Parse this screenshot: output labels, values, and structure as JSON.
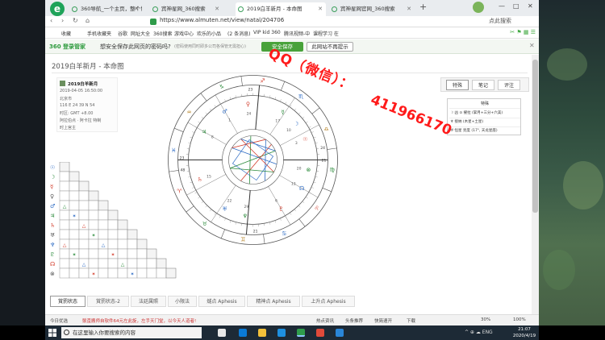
{
  "browser": {
    "tabs": [
      {
        "label": "360导航_一个主页，整个世界",
        "active": false
      },
      {
        "label": "宾神星网_360搜索",
        "active": false
      },
      {
        "label": "2019白羊新月 - 本命图",
        "active": true
      },
      {
        "label": "宾神星网官网_360搜索",
        "active": false
      }
    ],
    "new_tab": "+",
    "window_controls": [
      "—",
      "□",
      "✕"
    ],
    "url": "https://www.almuten.net/view/natal/204706",
    "search_placeholder": "点此搜索",
    "nav": {
      "back": "‹",
      "forward": "›",
      "reload": "↻",
      "home": "⌂"
    },
    "bookmarks": [
      "收藏",
      "手机收藏夹",
      "谷歌",
      "网址大全",
      "360搜索",
      "游戏中心",
      "欢乐的小品",
      "(2 条消息)",
      "VIP kid 360",
      "腾讯视频-中",
      "课程学习 在"
    ]
  },
  "prompt_bar": {
    "brand": "360 登录管家",
    "question": "想安全保存此网页的密码吗?",
    "subtext": "(密码使用同时即多公司各保管无需担心)",
    "save_label": "安全保存",
    "never_label": "此网站不再提示",
    "close": "✕"
  },
  "page": {
    "title": "2019白羊新月 - 本命图",
    "person": {
      "name": "2019白羊新月",
      "lines": [
        "2019-04-05 16:50:00",
        "北京市",
        "116 E 24  39 N 54",
        "时区: GMT +8.00",
        "阿拉伯点 · 阿卡拉 特制",
        "时上宫主"
      ]
    },
    "right_tabs": [
      "特殊",
      "笔记",
      "评注"
    ],
    "right_panel": {
      "header": "特殊",
      "lines": [
        "☽ 凶 ⊙ 擢拉 (掌月+三分+六美)",
        "♆ 接纳 (木星+土星)",
        "♅ 恒星 亮度 (17°, 天龙星座)"
      ]
    },
    "watermark_line1": "QQ（微信）：",
    "watermark_line2": "411966170",
    "bottom_tabs": [
      "賞罰状态",
      "賞罰状态-2",
      "法廷属照",
      "小限法",
      "燧点 Aphesis",
      "精神点 Aphesis",
      "上升点 Aphesis"
    ]
  },
  "chart_glyphs": {
    "signs": [
      "♈",
      "♉",
      "♊",
      "♋",
      "♌",
      "♍",
      "♎",
      "♏",
      "♐",
      "♑",
      "♒",
      "♓"
    ],
    "planets": [
      "☉",
      "☽",
      "☿",
      "♀",
      "♂",
      "♃",
      "♄",
      "♅",
      "♆",
      "♇",
      "☊",
      "⊗"
    ],
    "cusp_numbers": [
      "23",
      "48",
      "21",
      "24",
      "23",
      "21"
    ]
  },
  "status_bar": {
    "left": "今日优选",
    "news": "鬃歪搬师自软件64元左此旋，左手天门堂，以今天人道者!",
    "items": [
      "热点资讯",
      "头条推荐",
      "快简速开",
      "下载",
      "30%",
      "100%"
    ]
  },
  "taskbar": {
    "search_text": "在这里输入你要搜索的内容",
    "time": "21:07",
    "date": "2020/4/19",
    "tray": "^  ⊕  ☁  ENG"
  },
  "colors": {
    "fire": "#d23b2a",
    "water": "#2d6bc4",
    "earth": "#2a8a3a",
    "accent_green": "#48a23a",
    "watermark": "#ff1a1a"
  }
}
